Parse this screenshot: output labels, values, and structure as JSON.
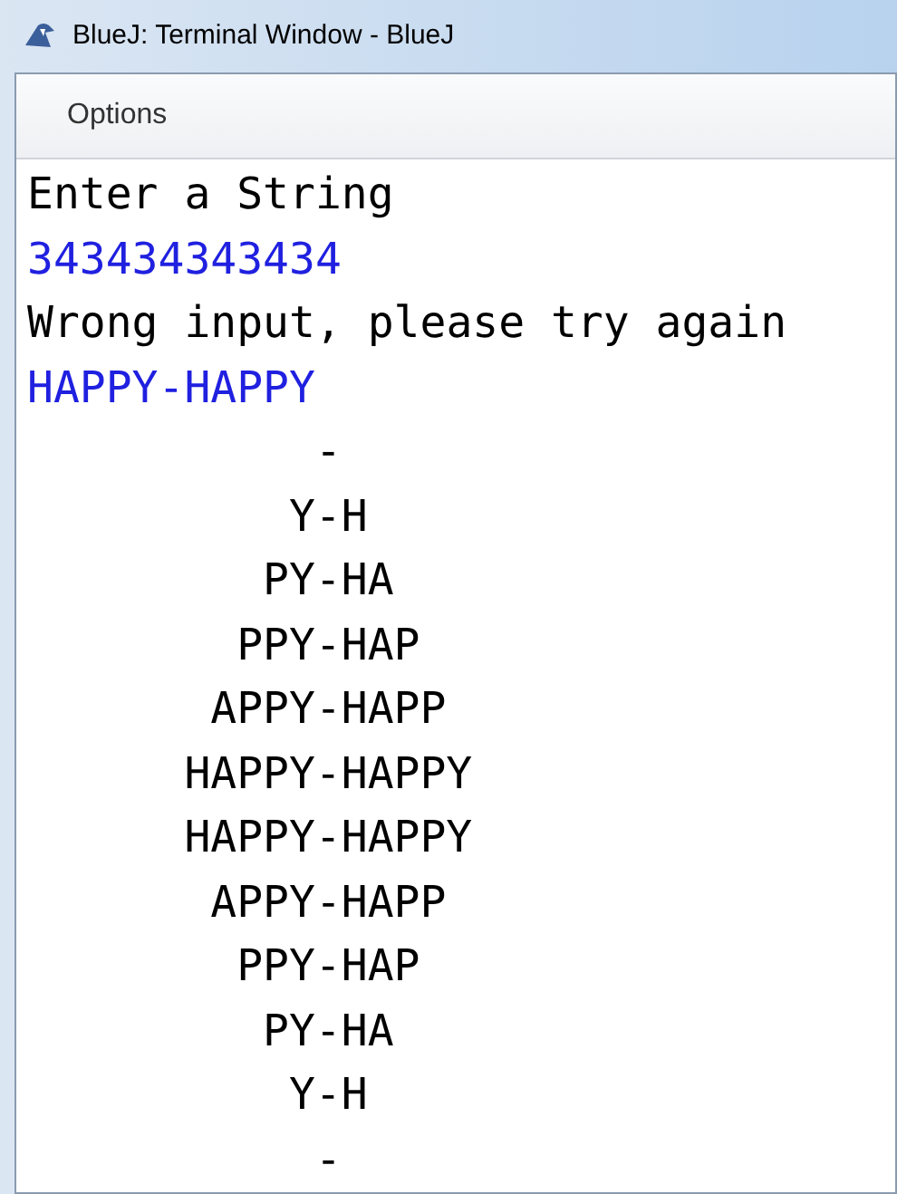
{
  "window": {
    "title": "BlueJ: Terminal Window - BlueJ"
  },
  "menu": [
    "Options"
  ],
  "terminal": {
    "lines": [
      {
        "kind": "output",
        "text": "Enter a String"
      },
      {
        "kind": "input",
        "text": "343434343434"
      },
      {
        "kind": "output",
        "text": "Wrong input, please try again"
      },
      {
        "kind": "input",
        "text": "HAPPY-HAPPY"
      },
      {
        "kind": "pattern",
        "text": "-"
      },
      {
        "kind": "pattern",
        "text": "Y-H"
      },
      {
        "kind": "pattern",
        "text": "PY-HA"
      },
      {
        "kind": "pattern",
        "text": "PPY-HAP"
      },
      {
        "kind": "pattern",
        "text": "APPY-HAPP"
      },
      {
        "kind": "pattern",
        "text": "HAPPY-HAPPY"
      },
      {
        "kind": "pattern",
        "text": "HAPPY-HAPPY"
      },
      {
        "kind": "pattern",
        "text": "APPY-HAPP"
      },
      {
        "kind": "pattern",
        "text": "PPY-HAP"
      },
      {
        "kind": "pattern",
        "text": "PY-HA"
      },
      {
        "kind": "pattern",
        "text": "Y-H"
      },
      {
        "kind": "pattern",
        "text": "-"
      }
    ]
  }
}
